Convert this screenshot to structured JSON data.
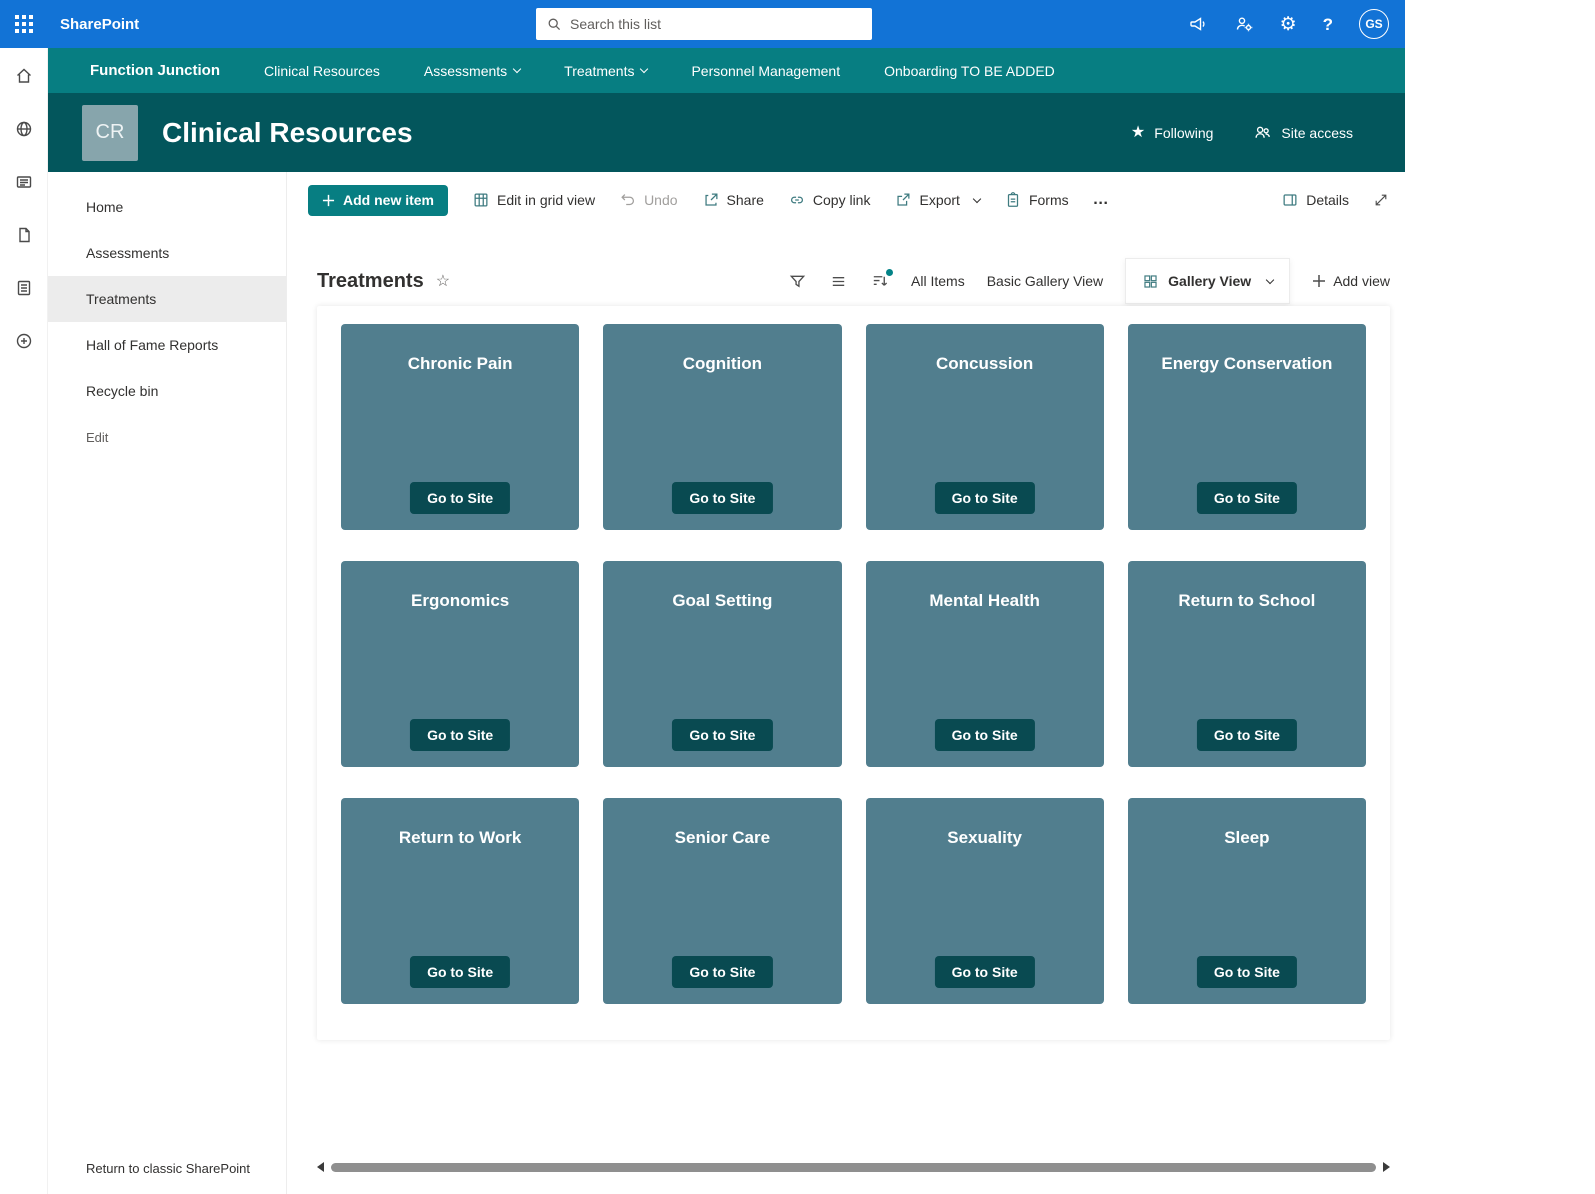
{
  "suite_bar": {
    "brand": "SharePoint",
    "search_placeholder": "Search this list",
    "avatar_initials": "GS"
  },
  "icons": {
    "gear": "⚙",
    "help": "?",
    "star_filled": "★",
    "star_outline": "☆"
  },
  "hub_nav": {
    "items": [
      {
        "label": "Function Junction",
        "bold": true,
        "chevron": false
      },
      {
        "label": "Clinical Resources",
        "bold": false,
        "chevron": false
      },
      {
        "label": "Assessments",
        "bold": false,
        "chevron": true
      },
      {
        "label": "Treatments",
        "bold": false,
        "chevron": true
      },
      {
        "label": "Personnel Management",
        "bold": false,
        "chevron": false
      },
      {
        "label": "Onboarding TO BE ADDED",
        "bold": false,
        "chevron": false
      }
    ]
  },
  "site_header": {
    "logo_text": "CR",
    "title": "Clinical Resources",
    "following_label": "Following",
    "site_access_label": "Site access"
  },
  "sidebar": {
    "items": [
      {
        "label": "Home",
        "selected": false,
        "muted": false
      },
      {
        "label": "Assessments",
        "selected": false,
        "muted": false
      },
      {
        "label": "Treatments",
        "selected": true,
        "muted": false
      },
      {
        "label": "Hall of Fame Reports",
        "selected": false,
        "muted": false
      },
      {
        "label": "Recycle bin",
        "selected": false,
        "muted": false
      },
      {
        "label": "Edit",
        "selected": false,
        "muted": true
      }
    ],
    "footer_link": "Return to classic SharePoint"
  },
  "command_bar": {
    "add_new_item_label": "Add new item",
    "edit_grid_label": "Edit in grid view",
    "undo_label": "Undo",
    "share_label": "Share",
    "copy_link_label": "Copy link",
    "export_label": "Export",
    "forms_label": "Forms",
    "more_label": "…",
    "details_label": "Details"
  },
  "view_bar": {
    "list_title": "Treatments",
    "all_items_label": "All Items",
    "basic_gallery_label": "Basic Gallery View",
    "gallery_view_label": "Gallery View",
    "add_view_label": "Add view"
  },
  "gallery": {
    "go_to_site_label": "Go to Site",
    "cards": [
      "Chronic Pain",
      "Cognition",
      "Concussion",
      "Energy Conservation",
      "Ergonomics",
      "Goal Setting",
      "Mental Health",
      "Return to School",
      "Return to Work",
      "Senior Care",
      "Sexuality",
      "Sleep"
    ]
  },
  "colors": {
    "suite_blue": "#1273d6",
    "hub_teal": "#077e82",
    "header_teal": "#03565c",
    "card_teal": "#517e8e",
    "button_dark_teal": "#094a51",
    "accent_teal": "#038387"
  }
}
